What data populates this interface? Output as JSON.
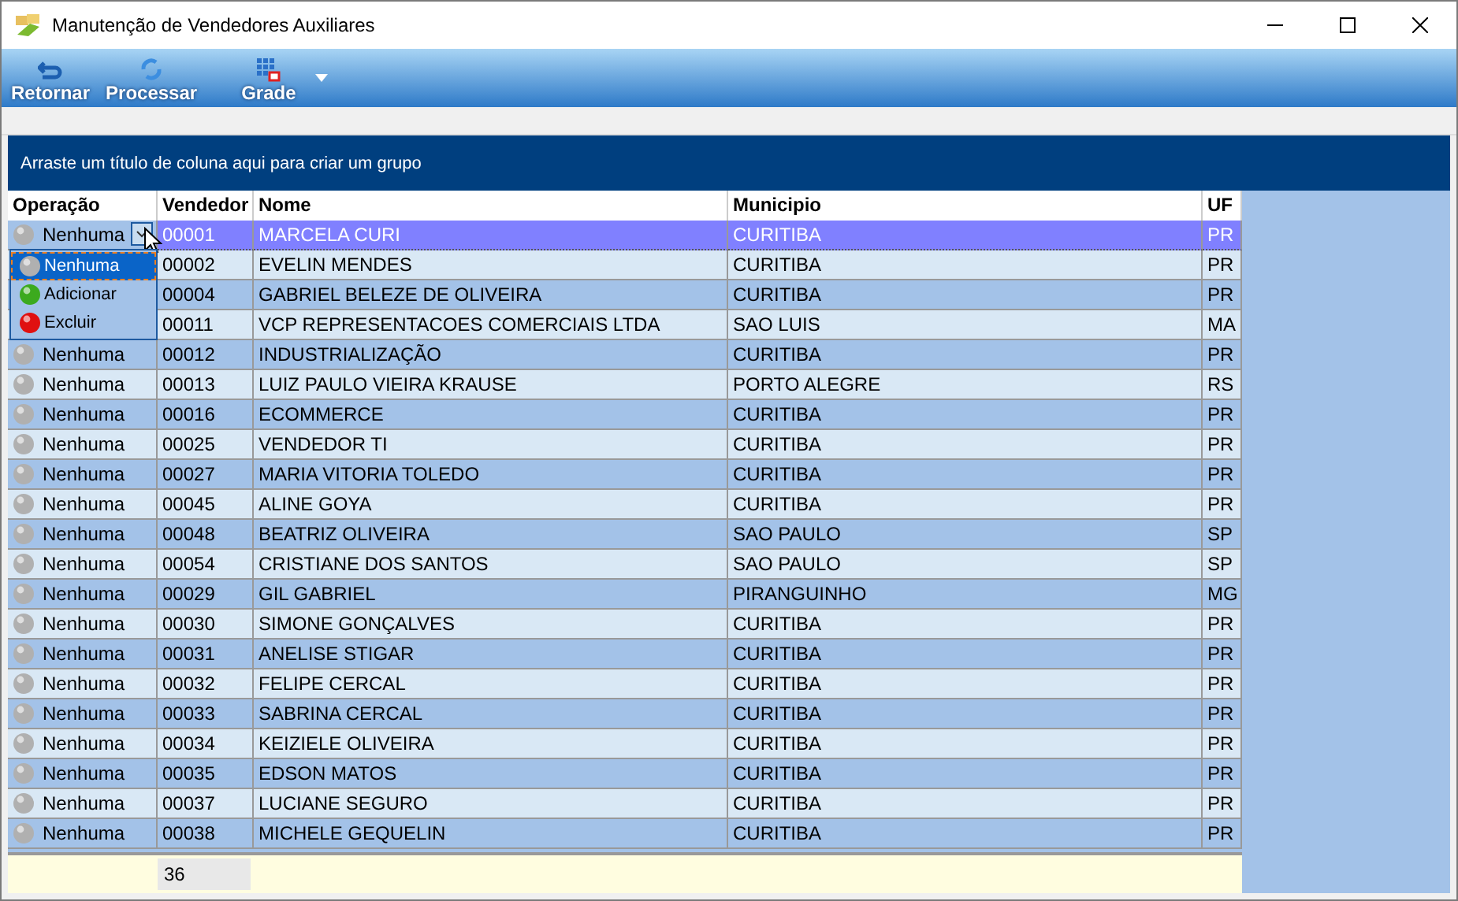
{
  "window": {
    "title": "Manutenção de Vendedores Auxiliares"
  },
  "toolbar": [
    {
      "label": "Retornar",
      "kind": "back"
    },
    {
      "label": "Processar",
      "kind": "refresh"
    },
    {
      "label": "Grade",
      "kind": "grid"
    }
  ],
  "group_panel": {
    "hint": "Arraste um título de coluna aqui para criar um grupo"
  },
  "table": {
    "columns": [
      "Operação",
      "Vendedor",
      "Nome",
      "Municipio",
      "UF"
    ],
    "rows": [
      {
        "operation": "Nenhuma",
        "code": "00001",
        "name": "MARCELA CURI",
        "city": "CURITIBA",
        "uf": "PR",
        "selected": true
      },
      {
        "code": "00002",
        "name": "EVELIN MENDES",
        "city": "CURITIBA",
        "uf": "PR",
        "selected": false
      },
      {
        "code": "00004",
        "name": "GABRIEL BELEZE DE OLIVEIRA",
        "city": "CURITIBA",
        "uf": "PR",
        "selected": false
      },
      {
        "code": "00011",
        "name": "VCP REPRESENTACOES COMERCIAIS LTDA",
        "city": "SAO LUIS",
        "uf": "MA",
        "selected": false
      },
      {
        "operation": "Nenhuma",
        "code": "00012",
        "name": "INDUSTRIALIZAÇÃO",
        "city": "CURITIBA",
        "uf": "PR",
        "selected": false
      },
      {
        "operation": "Nenhuma",
        "code": "00013",
        "name": "LUIZ PAULO VIEIRA KRAUSE",
        "city": "PORTO ALEGRE",
        "uf": "RS",
        "selected": false
      },
      {
        "operation": "Nenhuma",
        "code": "00016",
        "name": "ECOMMERCE",
        "city": "CURITIBA",
        "uf": "PR",
        "selected": false
      },
      {
        "operation": "Nenhuma",
        "code": "00025",
        "name": "VENDEDOR TI",
        "city": "CURITIBA",
        "uf": "PR",
        "selected": false
      },
      {
        "operation": "Nenhuma",
        "code": "00027",
        "name": "MARIA VITORIA TOLEDO",
        "city": "CURITIBA",
        "uf": "PR",
        "selected": false
      },
      {
        "operation": "Nenhuma",
        "code": "00045",
        "name": "ALINE GOYA",
        "city": "CURITIBA",
        "uf": "PR",
        "selected": false
      },
      {
        "operation": "Nenhuma",
        "code": "00048",
        "name": "BEATRIZ OLIVEIRA",
        "city": "SAO PAULO",
        "uf": "SP",
        "selected": false
      },
      {
        "operation": "Nenhuma",
        "code": "00054",
        "name": "CRISTIANE DOS SANTOS",
        "city": "SAO PAULO",
        "uf": "SP",
        "selected": false
      },
      {
        "operation": "Nenhuma",
        "code": "00029",
        "name": "GIL GABRIEL",
        "city": "PIRANGUINHO",
        "uf": "MG",
        "selected": false
      },
      {
        "operation": "Nenhuma",
        "code": "00030",
        "name": "SIMONE GONÇALVES",
        "city": "CURITIBA",
        "uf": "PR",
        "selected": false
      },
      {
        "operation": "Nenhuma",
        "code": "00031",
        "name": "ANELISE STIGAR",
        "city": "CURITIBA",
        "uf": "PR",
        "selected": false
      },
      {
        "operation": "Nenhuma",
        "code": "00032",
        "name": "FELIPE CERCAL",
        "city": "CURITIBA",
        "uf": "PR",
        "selected": false
      },
      {
        "operation": "Nenhuma",
        "code": "00033",
        "name": "SABRINA CERCAL",
        "city": "CURITIBA",
        "uf": "PR",
        "selected": false
      },
      {
        "operation": "Nenhuma",
        "code": "00034",
        "name": "KEIZIELE OLIVEIRA",
        "city": "CURITIBA",
        "uf": "PR",
        "selected": false
      },
      {
        "operation": "Nenhuma",
        "code": "00035",
        "name": "EDSON MATOS",
        "city": "CURITIBA",
        "uf": "PR",
        "selected": false
      },
      {
        "operation": "Nenhuma",
        "code": "00037",
        "name": "LUCIANE SEGURO",
        "city": "CURITIBA",
        "uf": "PR",
        "selected": false
      },
      {
        "operation": "Nenhuma",
        "code": "00038",
        "name": "MICHELE GEQUELIN",
        "city": "CURITIBA",
        "uf": "PR",
        "selected": false
      }
    ],
    "footer_count": "36"
  },
  "operation_dropdown": {
    "items": [
      {
        "label": "Nenhuma",
        "color": "#b0b0b0",
        "selected": true
      },
      {
        "label": "Adicionar",
        "color": "#3caa1e",
        "selected": false
      },
      {
        "label": "Excluir",
        "color": "#e01010",
        "selected": false
      }
    ]
  }
}
